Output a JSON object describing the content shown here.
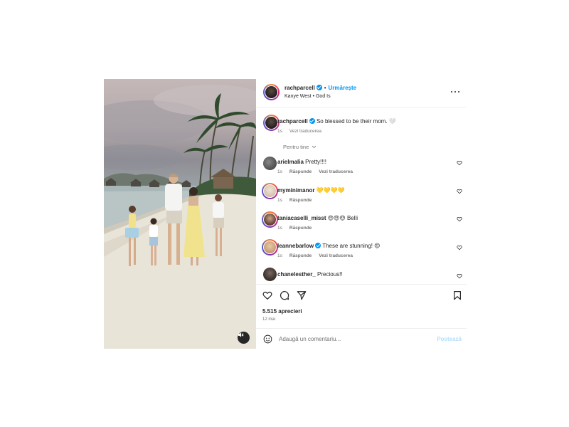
{
  "header": {
    "username": "rachparcell",
    "follow_label": "Urmărește",
    "artist": "Kanye West",
    "song": "God Is"
  },
  "caption": {
    "username": "rachparcell",
    "text": "So blessed to be their mom. 🤍",
    "time": "1s",
    "translate": "Vezi traducerea"
  },
  "sort": {
    "label": "Pentru tine"
  },
  "comments": [
    {
      "username": "arielmalia",
      "text": "Pretty!!!!",
      "time": "1s",
      "reply": "Răspunde",
      "translate": "Vezi traducerea",
      "verified": false
    },
    {
      "username": "myminimanor",
      "text": "💛💛💛💛",
      "time": "1s",
      "reply": "Răspunde",
      "translate": "",
      "verified": false
    },
    {
      "username": "taniacaselli_misst",
      "text": "😍😍😍 Belli",
      "time": "1s",
      "reply": "Răspunde",
      "translate": "",
      "verified": false
    },
    {
      "username": "leannebarlow",
      "text": "These are stunning! 😍",
      "time": "1s",
      "reply": "Răspunde",
      "translate": "Vezi traducerea",
      "verified": true
    },
    {
      "username": "chanelesther_",
      "text": "Precious!!",
      "time": "",
      "reply": "",
      "translate": "",
      "verified": false
    }
  ],
  "stats": {
    "likes": "5.515 aprecieri",
    "date": "12 mai"
  },
  "composer": {
    "placeholder": "Adaugă un comentariu...",
    "post_label": "Postează"
  },
  "colors": {
    "accent": "#0095f6",
    "muted": "#737373",
    "post_disabled": "#b2dffc"
  },
  "icons": [
    "like-icon",
    "comment-icon",
    "share-icon",
    "save-icon",
    "emoji-icon",
    "mute-icon",
    "more-icon",
    "verified-icon",
    "heart-icon"
  ]
}
